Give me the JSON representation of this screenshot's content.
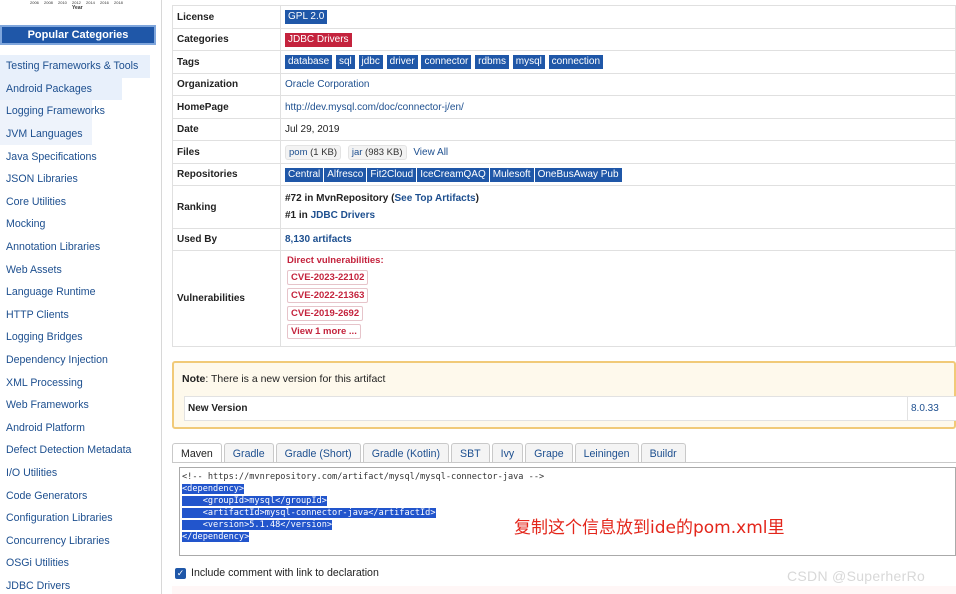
{
  "sidebar": {
    "chart_ticks": [
      "2006",
      "2008",
      "2010",
      "2012",
      "2014",
      "2016",
      "2018"
    ],
    "chart_axis_title": "Year",
    "header": "Popular Categories",
    "items": [
      "Testing Frameworks & Tools",
      "Android Packages",
      "Logging Frameworks",
      "JVM Languages",
      "Java Specifications",
      "JSON Libraries",
      "Core Utilities",
      "Mocking",
      "Annotation Libraries",
      "Web Assets",
      "Language Runtime",
      "HTTP Clients",
      "Logging Bridges",
      "Dependency Injection",
      "XML Processing",
      "Web Frameworks",
      "Android Platform",
      "Defect Detection Metadata",
      "I/O Utilities",
      "Code Generators",
      "Configuration Libraries",
      "Concurrency Libraries",
      "OSGi Utilities",
      "JDBC Drivers"
    ]
  },
  "info": {
    "license": {
      "label": "License",
      "value": "GPL 2.0"
    },
    "categories": {
      "label": "Categories",
      "value": "JDBC Drivers"
    },
    "tags": {
      "label": "Tags",
      "values": [
        "database",
        "sql",
        "jdbc",
        "driver",
        "connector",
        "rdbms",
        "mysql",
        "connection"
      ]
    },
    "organization": {
      "label": "Organization",
      "value": "Oracle Corporation"
    },
    "homepage": {
      "label": "HomePage",
      "value": "http://dev.mysql.com/doc/connector-j/en/"
    },
    "date": {
      "label": "Date",
      "value": "Jul 29, 2019"
    },
    "files": {
      "label": "Files",
      "pom_name": "pom",
      "pom_size": " (1 KB)",
      "jar_name": "jar",
      "jar_size": " (983 KB)",
      "view_all": "View All"
    },
    "repositories": {
      "label": "Repositories",
      "values": [
        "Central",
        "Alfresco",
        "Fit2Cloud",
        "IceCreamQAQ",
        "Mulesoft",
        "OneBusAway Pub"
      ]
    },
    "ranking": {
      "label": "Ranking",
      "line1_prefix": "#72 in MvnRepository (",
      "line1_link": "See Top Artifacts",
      "line1_suffix": ")",
      "line2_prefix": "#1 in ",
      "line2_link": "JDBC Drivers"
    },
    "used_by": {
      "label": "Used By",
      "value": "8,130 artifacts"
    },
    "vulnerabilities": {
      "label": "Vulnerabilities",
      "heading": "Direct vulnerabilities:",
      "cves": [
        "CVE-2023-22102",
        "CVE-2022-21363",
        "CVE-2019-2692"
      ],
      "more": "View 1 more ..."
    }
  },
  "note": {
    "bold": "Note",
    "text": ": There is a new version for this artifact",
    "new_version_label": "New Version",
    "new_version_value": "8.0.33"
  },
  "tabs": [
    "Maven",
    "Gradle",
    "Gradle (Short)",
    "Gradle (Kotlin)",
    "SBT",
    "Ivy",
    "Grape",
    "Leiningen",
    "Buildr"
  ],
  "code": {
    "comment": "<!-- https://mvnrepository.com/artifact/mysql/mysql-connector-java -->",
    "lines": [
      "<dependency>",
      "    <groupId>mysql</groupId>",
      "    <artifactId>mysql-connector-java</artifactId>",
      "    <version>5.1.48</version>",
      "</dependency>"
    ]
  },
  "annotation": "复制这个信息放到ide的pom.xml里",
  "include_comment": "Include comment with link to declaration",
  "watermark": "CSDN @SuperherRo",
  "colors": {
    "accent": "#1f57a8",
    "danger": "#c4233d",
    "note_border": "#f1ca78"
  }
}
